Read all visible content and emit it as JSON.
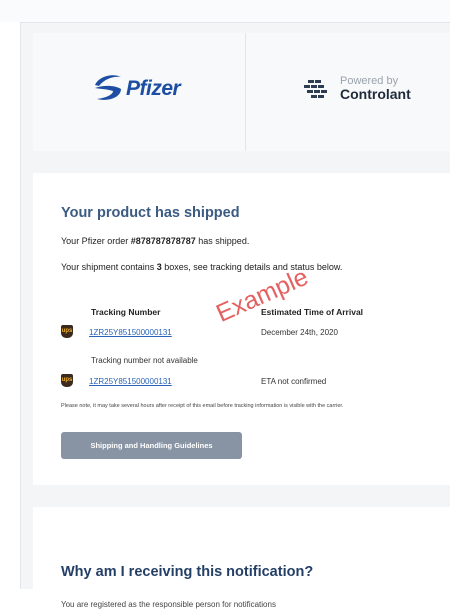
{
  "header": {
    "pfizer_logo_text": "Pfizer",
    "powered_by": "Powered by",
    "partner_name": "Controlant"
  },
  "shipment": {
    "heading": "Your product has shipped",
    "order_prefix": "Your Pfizer order ",
    "order_number": "#878787878787",
    "order_suffix": " has shipped.",
    "boxes_prefix": "Your shipment contains ",
    "boxes_count": "3",
    "boxes_suffix": " boxes, see tracking details and status below.",
    "table": {
      "col_tracking": "Tracking Number",
      "col_eta": "Estimated Time of Arrival",
      "rows": [
        {
          "carrier_icon": "ups-icon",
          "tracking": "1ZR25Y851500000131",
          "eta": "December 24th, 2020"
        },
        {
          "carrier_icon": "",
          "tracking": "Tracking number not available",
          "eta": ""
        },
        {
          "carrier_icon": "ups-icon",
          "tracking": "1ZR25Y851500000131",
          "eta": "ETA not confirmed"
        }
      ]
    },
    "note": "Please note, it may take several hours after receipt of this email before tracking information is visible with the carrier.",
    "button_label": "Shipping and Handling Guidelines",
    "watermark": "Example"
  },
  "why": {
    "title": "Why am I receiving this notification?",
    "text": "You are registered as the responsible person for notifications"
  },
  "colors": {
    "brand_blue": "#1d4ea3",
    "heading_blue": "#3b5b83",
    "link_blue": "#2b63b8",
    "button_gray": "#8894a3",
    "watermark_red": "#e24b4b"
  }
}
